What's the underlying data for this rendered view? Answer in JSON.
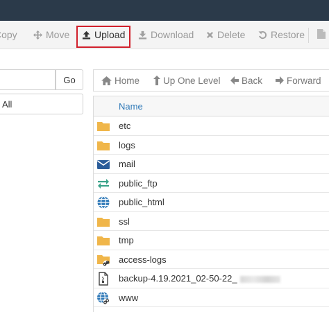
{
  "toolbar": {
    "copy_label": "Copy",
    "move_label": "Move",
    "upload_label": "Upload",
    "download_label": "Download",
    "delete_label": "Delete",
    "restore_label": "Restore"
  },
  "left": {
    "go_label": "Go",
    "all_label": "All"
  },
  "nav": {
    "home_label": "Home",
    "up_label": "Up One Level",
    "back_label": "Back",
    "forward_label": "Forward"
  },
  "table": {
    "name_header": "Name",
    "rows": [
      {
        "name": "etc",
        "icon": "folder-icon"
      },
      {
        "name": "logs",
        "icon": "folder-icon"
      },
      {
        "name": "mail",
        "icon": "envelope-icon"
      },
      {
        "name": "public_ftp",
        "icon": "transfer-arrows-icon"
      },
      {
        "name": "public_html",
        "icon": "globe-icon"
      },
      {
        "name": "ssl",
        "icon": "folder-icon"
      },
      {
        "name": "tmp",
        "icon": "folder-icon"
      },
      {
        "name": "access-logs",
        "icon": "folder-link-icon"
      },
      {
        "name": "backup-4.19.2021_02-50-22_",
        "icon": "archive-file-icon"
      },
      {
        "name": "www",
        "icon": "globe-link-icon"
      }
    ]
  },
  "colors": {
    "topbar": "#2b3a4a",
    "highlight_border": "#d11f2b",
    "folder": "#f0b64a",
    "mail": "#2a5c9a",
    "ftp": "#3aa38a",
    "globe": "#2f79b8",
    "header_text": "#2f79b8"
  }
}
